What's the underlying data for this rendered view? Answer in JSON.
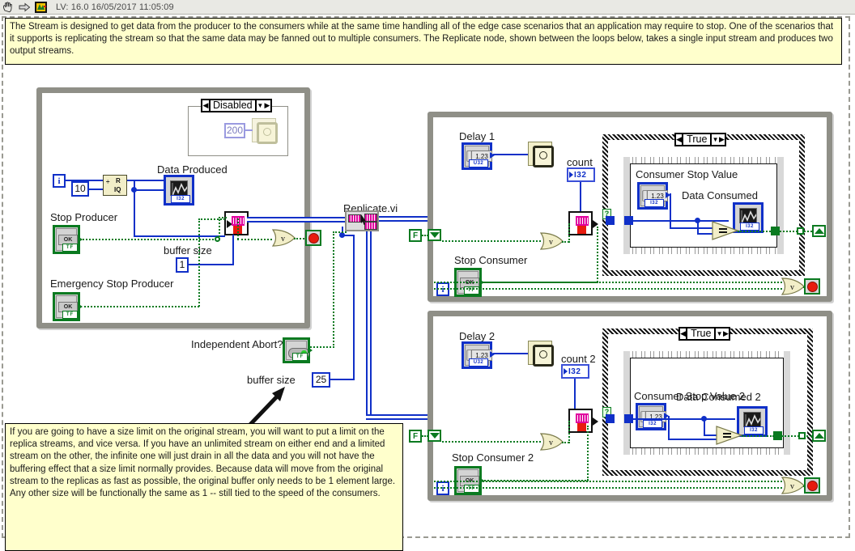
{
  "titlebar": {
    "icons": [
      "hand-cursor-icon",
      "run-arrow-icon",
      "labview-vi-icon"
    ],
    "title": "LV: 16.0 16/05/2017 11:05:09"
  },
  "comments": {
    "top": "The Stream is designed to get data from the producer to the consumers while at the same time handling all of the edge case scenarios that an application may require to stop. One of the scenarios that it supports is replicating the stream so that the same data may be fanned out to multiple consumers. The Replicate node, shown between the loops below, takes a single input stream and produces two output streams.",
    "bottom": "If you are going to have a size limit on the original stream, you will want to put a limit on the replica streams, and vice versa. If you have an unlimited stream on either end and a limited stream on the other, the infinite one will just drain in all the data and you will not have the buffering effect that a size limit normally provides. Because data will move from the original stream to the replicas as fast as possible, the original buffer only needs to be 1 element large. Any other size will be functionally the same as 1 -- still tied to the speed of the consumers."
  },
  "producer_loop": {
    "name": "producer-while-loop",
    "disable_structure": {
      "case_label": "Disabled",
      "wait_constant": "200"
    },
    "iteration_terminal": "i",
    "divisor_constant": "10",
    "quotient_remainder": {
      "top": "R",
      "bottom": "IQ"
    },
    "data_produced_label": "Data Produced",
    "data_produced_type": "I32",
    "stop_producer_label": "Stop Producer",
    "stop_producer_value": "OK",
    "stop_producer_type": "TF",
    "emergency_stop_label": "Emergency Stop Producer",
    "emergency_stop_value": "OK",
    "emergency_stop_type": "TF",
    "buffer_size_label": "buffer size",
    "buffer_size_value": "1"
  },
  "middle": {
    "replicate_label": "Replicate.vi",
    "independent_abort_label": "Independent Abort?",
    "independent_abort_type": "TF",
    "replica_buffer_label": "buffer size",
    "replica_buffer_value": "25"
  },
  "consumer1": {
    "name": "consumer-1-while-loop",
    "delay_label": "Delay 1",
    "delay_value": "1.23",
    "delay_type": "U32",
    "count_label": "count",
    "count_type": "I32",
    "stop_label": "Stop Consumer",
    "stop_value": "OK",
    "stop_type": "TF",
    "iteration_terminal": "i",
    "false_tunnel": "F",
    "case_label": "True",
    "consumer_stop_value_label": "Consumer Stop Value",
    "consumer_stop_value": "1.23",
    "consumer_stop_type": "I32",
    "data_consumed_label": "Data Consumed",
    "data_consumed_type": "I32"
  },
  "consumer2": {
    "name": "consumer-2-while-loop",
    "delay_label": "Delay 2",
    "delay_value": "1.23",
    "delay_type": "U32",
    "count_label": "count 2",
    "count_type": "I32",
    "stop_label": "Stop Consumer 2",
    "stop_value": "OK",
    "stop_type": "TF",
    "iteration_terminal": "i",
    "false_tunnel": "F",
    "case_label": "True",
    "consumer_stop_value_label": "Consumer Stop Value 2",
    "consumer_stop_value": "1.23",
    "consumer_stop_type": "I32",
    "data_consumed_label": "Data Consumed 2",
    "data_consumed_type": "I32"
  },
  "colors": {
    "wire_blue": "#1030c8",
    "wire_green": "#0a7a20",
    "comment_bg": "#ffffcc",
    "structure_gray": "#8f8f87",
    "stop_red": "#e81b0e",
    "node_tan": "#f2eec8"
  }
}
